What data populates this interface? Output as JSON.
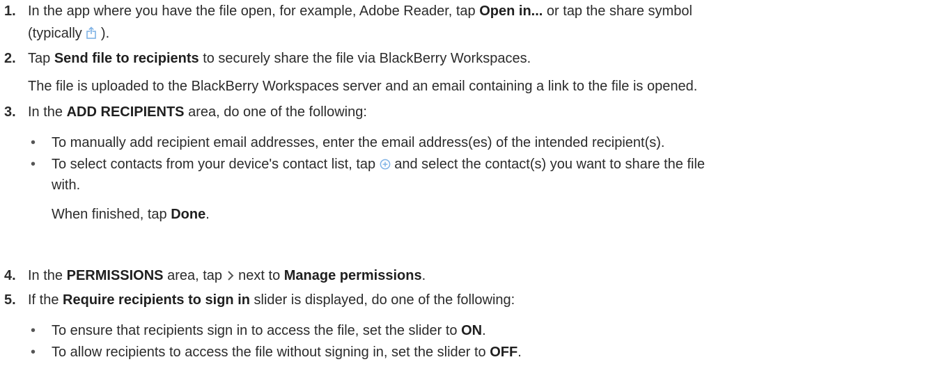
{
  "steps": [
    {
      "number": "1.",
      "line1_a": "In the app where you have the file open, for example, Adobe Reader, tap ",
      "line1_b": "Open in...",
      "line1_c": " or tap the share symbol",
      "line2_a": "(typically ",
      "line2_b": ")."
    },
    {
      "number": "2.",
      "a": "Tap ",
      "b": "Send file to recipients",
      "c": " to securely share the file via BlackBerry Workspaces.",
      "note": "The file is uploaded to the BlackBerry Workspaces server and an email containing a link to the file is opened."
    },
    {
      "number": "3.",
      "a": "In the ",
      "b": "ADD RECIPIENTS",
      "c": " area, do one of the following:",
      "bullets": [
        {
          "text": "To manually add recipient email addresses, enter the email address(es) of the intended recipient(s)."
        },
        {
          "text_a": "To select contacts from your device's contact list, tap ",
          "text_b": " and select the contact(s) you want to share the file",
          "text_c": "with."
        }
      ],
      "followup_a": "When finished, tap ",
      "followup_b": "Done",
      "followup_c": "."
    },
    {
      "number": "4.",
      "a": "In the ",
      "b": "PERMISSIONS",
      "c": " area, tap ",
      "d": " next to ",
      "e": "Manage permissions",
      "f": "."
    },
    {
      "number": "5.",
      "a": "If the ",
      "b": "Require recipients to sign in",
      "c": " slider is displayed, do one of the following:",
      "bullets": [
        {
          "text_a": "To ensure that recipients sign in to access the file, set the slider to ",
          "text_b": "ON",
          "text_c": "."
        },
        {
          "text_a": "To allow recipients to access the file without signing in, set the slider to ",
          "text_b": "OFF",
          "text_c": "."
        }
      ]
    }
  ],
  "icons": {
    "share": "share-icon",
    "add": "add-circle-icon",
    "chevron": "chevron-right-icon"
  },
  "colors": {
    "text": "#2b2b2b",
    "icon_blue": "#7fb2e5",
    "chevron": "#555555"
  },
  "bullet_char": "•"
}
